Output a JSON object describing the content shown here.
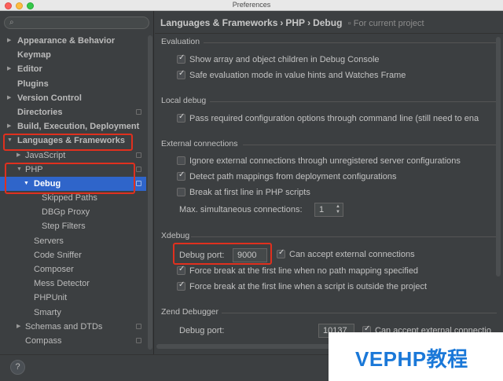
{
  "window": {
    "title": "Preferences"
  },
  "search": {
    "placeholder": ""
  },
  "sidebar": {
    "items": [
      {
        "label": "Appearance & Behavior"
      },
      {
        "label": "Keymap"
      },
      {
        "label": "Editor"
      },
      {
        "label": "Plugins"
      },
      {
        "label": "Version Control"
      },
      {
        "label": "Directories"
      },
      {
        "label": "Build, Execution, Deployment"
      },
      {
        "label": "Languages & Frameworks"
      },
      {
        "label": "JavaScript"
      },
      {
        "label": "PHP"
      },
      {
        "label": "Debug"
      },
      {
        "label": "Skipped Paths"
      },
      {
        "label": "DBGp Proxy"
      },
      {
        "label": "Step Filters"
      },
      {
        "label": "Servers"
      },
      {
        "label": "Code Sniffer"
      },
      {
        "label": "Composer"
      },
      {
        "label": "Mess Detector"
      },
      {
        "label": "PHPUnit"
      },
      {
        "label": "Smarty"
      },
      {
        "label": "Schemas and DTDs"
      },
      {
        "label": "Compass"
      }
    ]
  },
  "breadcrumb": {
    "part1": "Languages & Frameworks",
    "sep": "›",
    "part2": "PHP",
    "part3": "Debug",
    "scope": "For current project"
  },
  "sections": {
    "evaluation": {
      "title": "Evaluation",
      "show_array": "Show array and object children in Debug Console",
      "safe_eval": "Safe evaluation mode in value hints and Watches Frame"
    },
    "local_debug": {
      "title": "Local debug",
      "pass_config": "Pass required configuration options through command line (still need to ena"
    },
    "external": {
      "title": "External connections",
      "ignore": "Ignore external connections through unregistered server configurations",
      "detect": "Detect path mappings from deployment configurations",
      "break_first": "Break at first line in PHP scripts",
      "max_label": "Max. simultaneous connections:",
      "max_value": "1"
    },
    "xdebug": {
      "title": "Xdebug",
      "port_label": "Debug port:",
      "port_value": "9000",
      "accept_external": "Can accept external connections",
      "force_break_no_mapping": "Force break at the first line when no path mapping specified",
      "force_break_outside": "Force break at the first line when a script is outside the project"
    },
    "zend": {
      "title": "Zend Debugger",
      "port_label": "Debug port:",
      "port_value": "10137",
      "accept_external": "Can accept external connectio"
    }
  },
  "bottom": {
    "help": "?"
  },
  "watermark": {
    "text": "VEPHP教程"
  }
}
